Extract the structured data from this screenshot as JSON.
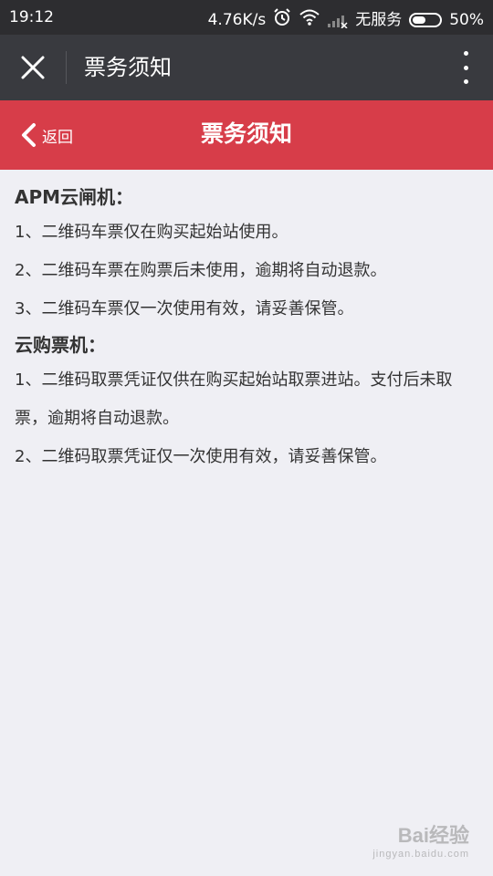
{
  "status_bar": {
    "time": "19:12",
    "speed": "4.76K/s",
    "carrier": "无服务",
    "battery_percent": "50%",
    "battery_level": 0.5,
    "icons": [
      "alarm-icon",
      "wifi-icon",
      "signal-icon",
      "battery-icon"
    ]
  },
  "app_header": {
    "title": "票务须知",
    "close_icon": "close-icon",
    "more_icon": "more-vertical-icon"
  },
  "page_header": {
    "back_label": "返回",
    "title": "票务须知",
    "background_color": "#d73d49"
  },
  "content": {
    "sections": [
      {
        "title": "APM云闸机：",
        "items": [
          "1、二维码车票仅在购买起始站使用。",
          "2、二维码车票在购票后未使用，逾期将自动退款。",
          "3、二维码车票仅一次使用有效，请妥善保管。"
        ]
      },
      {
        "title": "云购票机：",
        "items": [
          "1、二维码取票凭证仅供在购买起始站取票进站。支付后未取票，逾期将自动退款。",
          "2、二维码取票凭证仅一次使用有效，请妥善保管。"
        ]
      }
    ]
  },
  "watermark": {
    "brand": "Bai经验",
    "sub": "jingyan.baidu.com"
  }
}
